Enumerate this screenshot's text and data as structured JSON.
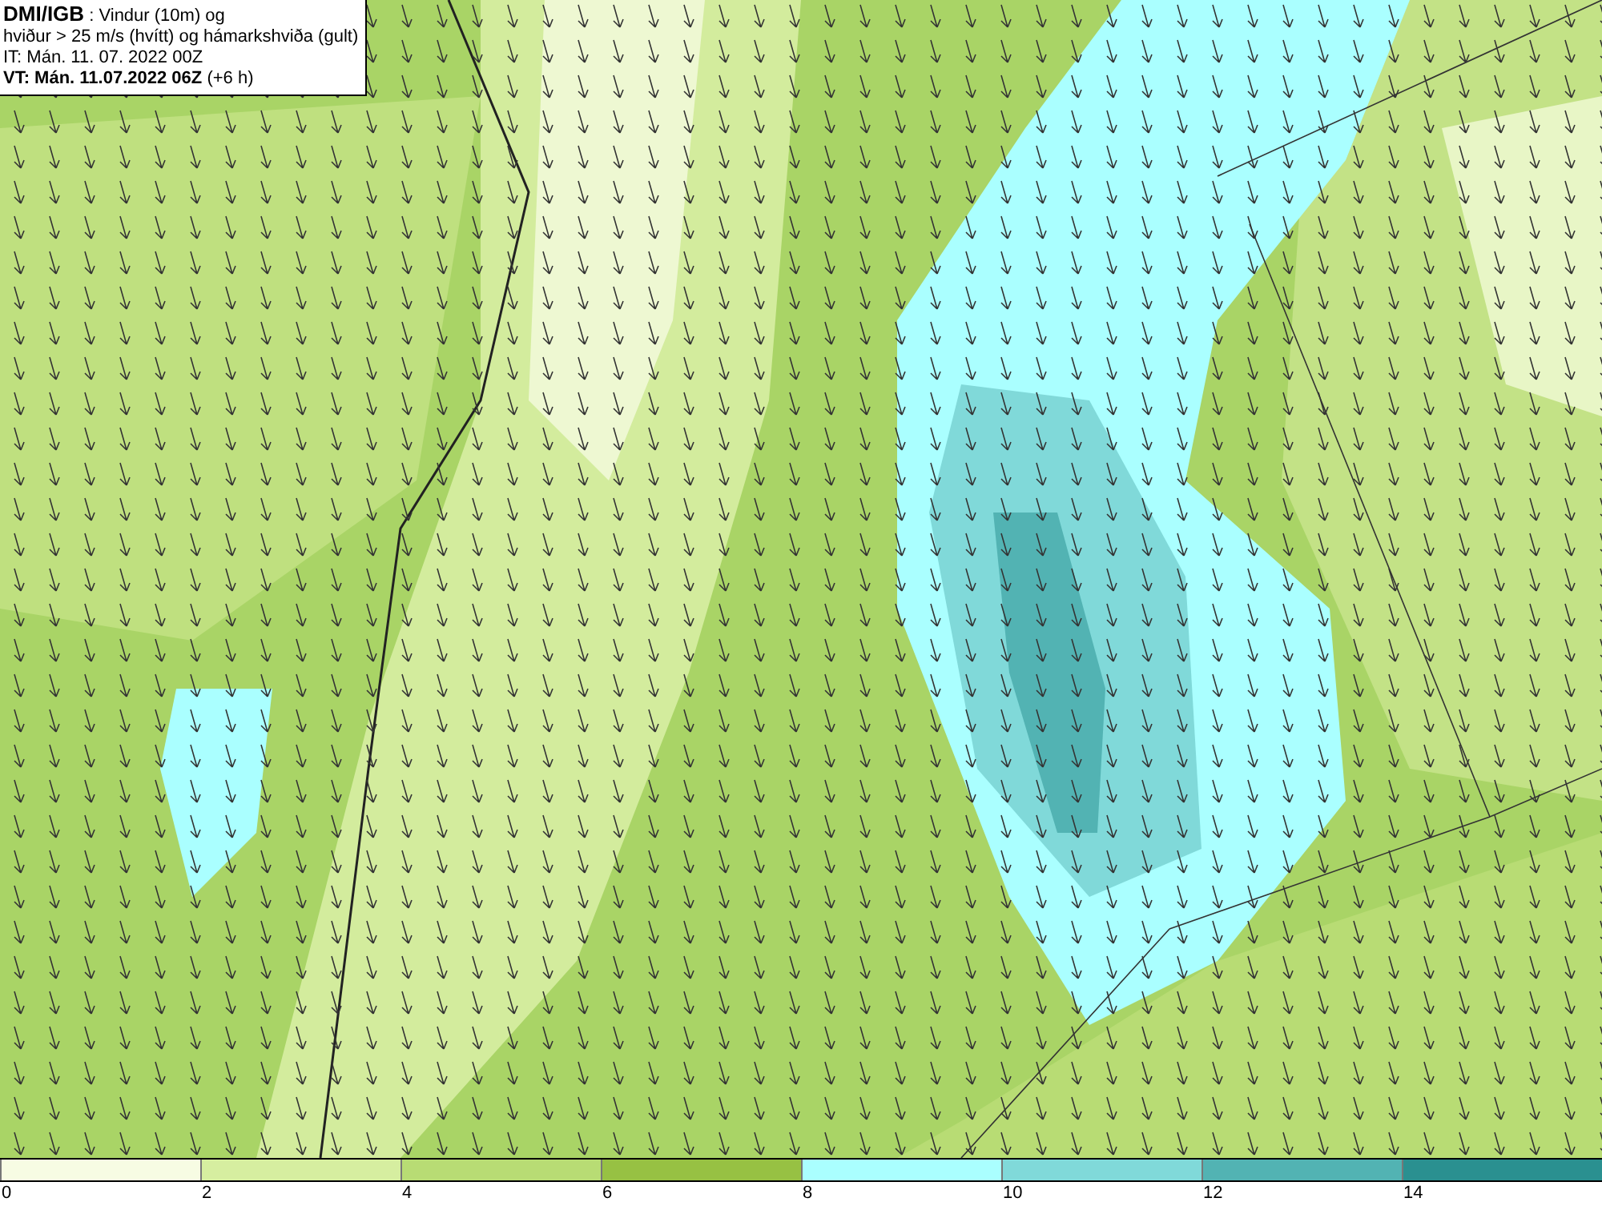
{
  "header": {
    "lines": [
      "**DMI/IGB** : Vindur (10m) og",
      "hviður > 25 m/s (hvítt) og hámarkshviða (gult)",
      "IT: Mán. 11. 07. 2022 00Z",
      "**VT: Mán. 11.07.2022 06Z** (+6 h)"
    ]
  },
  "legend": {
    "bins": [
      {
        "color": "#f7fce3",
        "label": "0"
      },
      {
        "color": "#d6eea0",
        "label": "2"
      },
      {
        "color": "#b8dc74",
        "label": "4"
      },
      {
        "color": "#97c143",
        "label": "6"
      },
      {
        "color": "#aaffff",
        "label": "8"
      },
      {
        "color": "#80d9d9",
        "label": "10"
      },
      {
        "color": "#52b3b3",
        "label": "12"
      },
      {
        "color": "#2a9090",
        "label": "14"
      }
    ]
  }
}
